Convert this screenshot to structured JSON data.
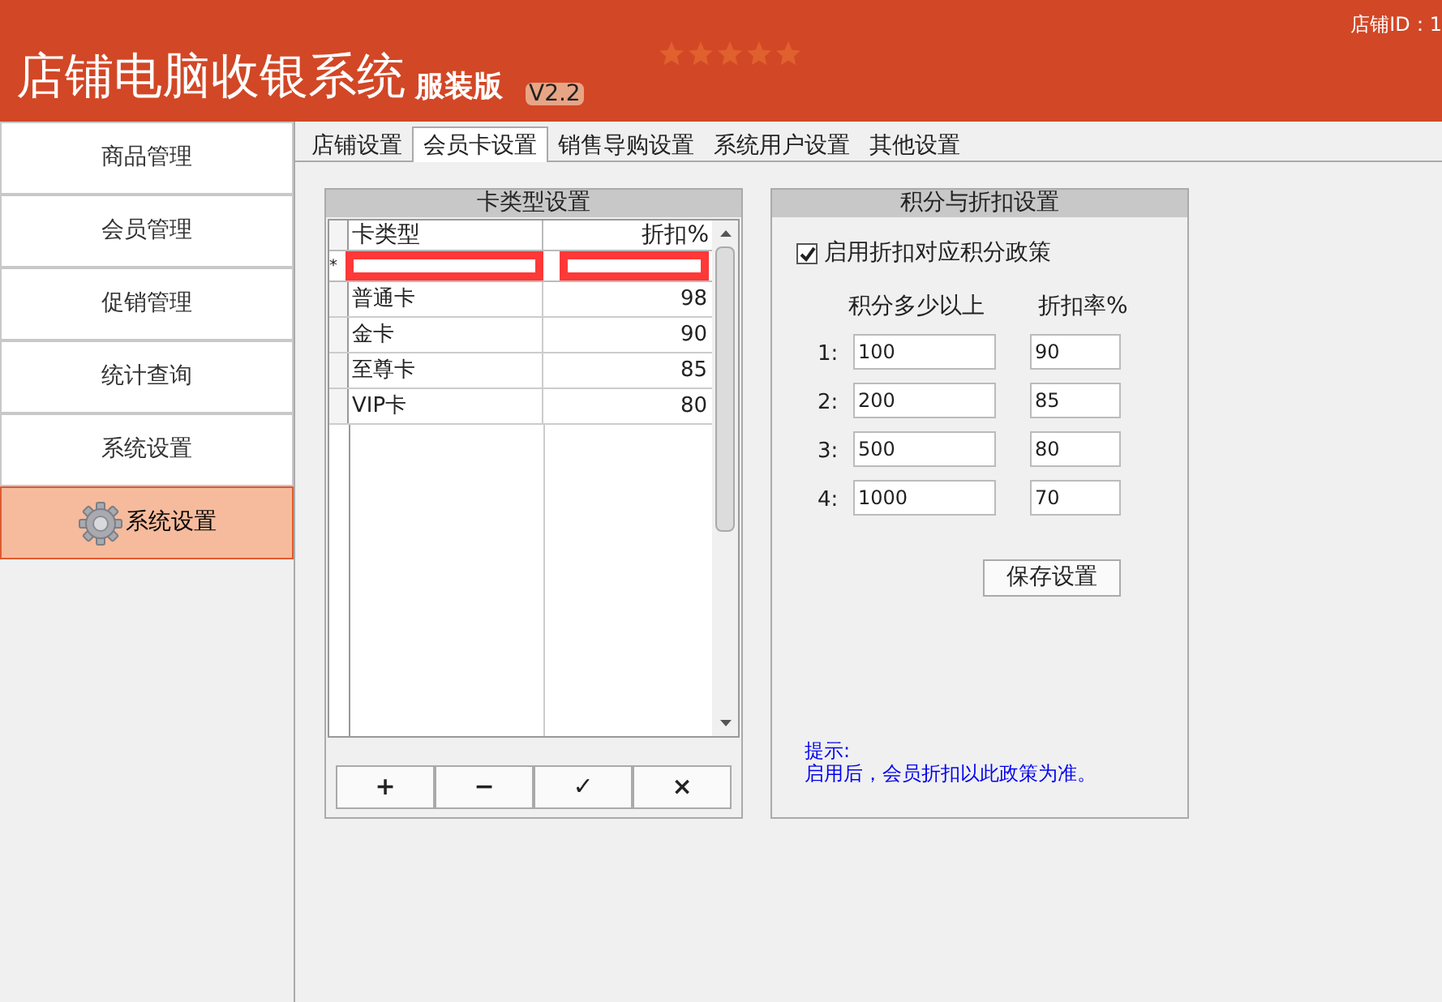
{
  "header": {
    "title": "店铺电脑收银系统",
    "edition": "服装版",
    "version": "V2.2",
    "stars": 5,
    "store_id": "店铺ID：1"
  },
  "sidebar": {
    "items": [
      {
        "label": "商品管理",
        "selected": false
      },
      {
        "label": "会员管理",
        "selected": false
      },
      {
        "label": "促销管理",
        "selected": false
      },
      {
        "label": "统计查询",
        "selected": false
      },
      {
        "label": "系统设置",
        "selected": false
      },
      {
        "label": "系统设置",
        "selected": true
      }
    ]
  },
  "tabs": [
    {
      "label": "店铺设置",
      "selected": false
    },
    {
      "label": "会员卡设置",
      "selected": true
    },
    {
      "label": "销售导购设置",
      "selected": false
    },
    {
      "label": "系统用户设置",
      "selected": false
    },
    {
      "label": "其他设置",
      "selected": false
    }
  ],
  "card_types": {
    "title": "卡类型设置",
    "columns": [
      "卡类型",
      "折扣%"
    ],
    "new_row_marker": "*",
    "rows": [
      {
        "name": "普通卡",
        "discount": "98"
      },
      {
        "name": "金卡",
        "discount": "90"
      },
      {
        "name": "至尊卡",
        "discount": "85"
      },
      {
        "name": "VIP卡",
        "discount": "80"
      }
    ],
    "buttons": [
      "+",
      "−",
      "✓",
      "×"
    ]
  },
  "points": {
    "title": "积分与折扣设置",
    "checkbox": {
      "label": "启用折扣对应积分政策",
      "checked": true
    },
    "column_headers": [
      "积分多少以上",
      "折扣率%"
    ],
    "tiers": [
      {
        "index": "1:",
        "points": "100",
        "rate": "90"
      },
      {
        "index": "2:",
        "points": "200",
        "rate": "85"
      },
      {
        "index": "3:",
        "points": "500",
        "rate": "80"
      },
      {
        "index": "4:",
        "points": "1000",
        "rate": "70"
      }
    ],
    "save_button": "保存设置",
    "hint_title": "提示:",
    "hint": "启用后，会员折扣以此政策为准。"
  }
}
